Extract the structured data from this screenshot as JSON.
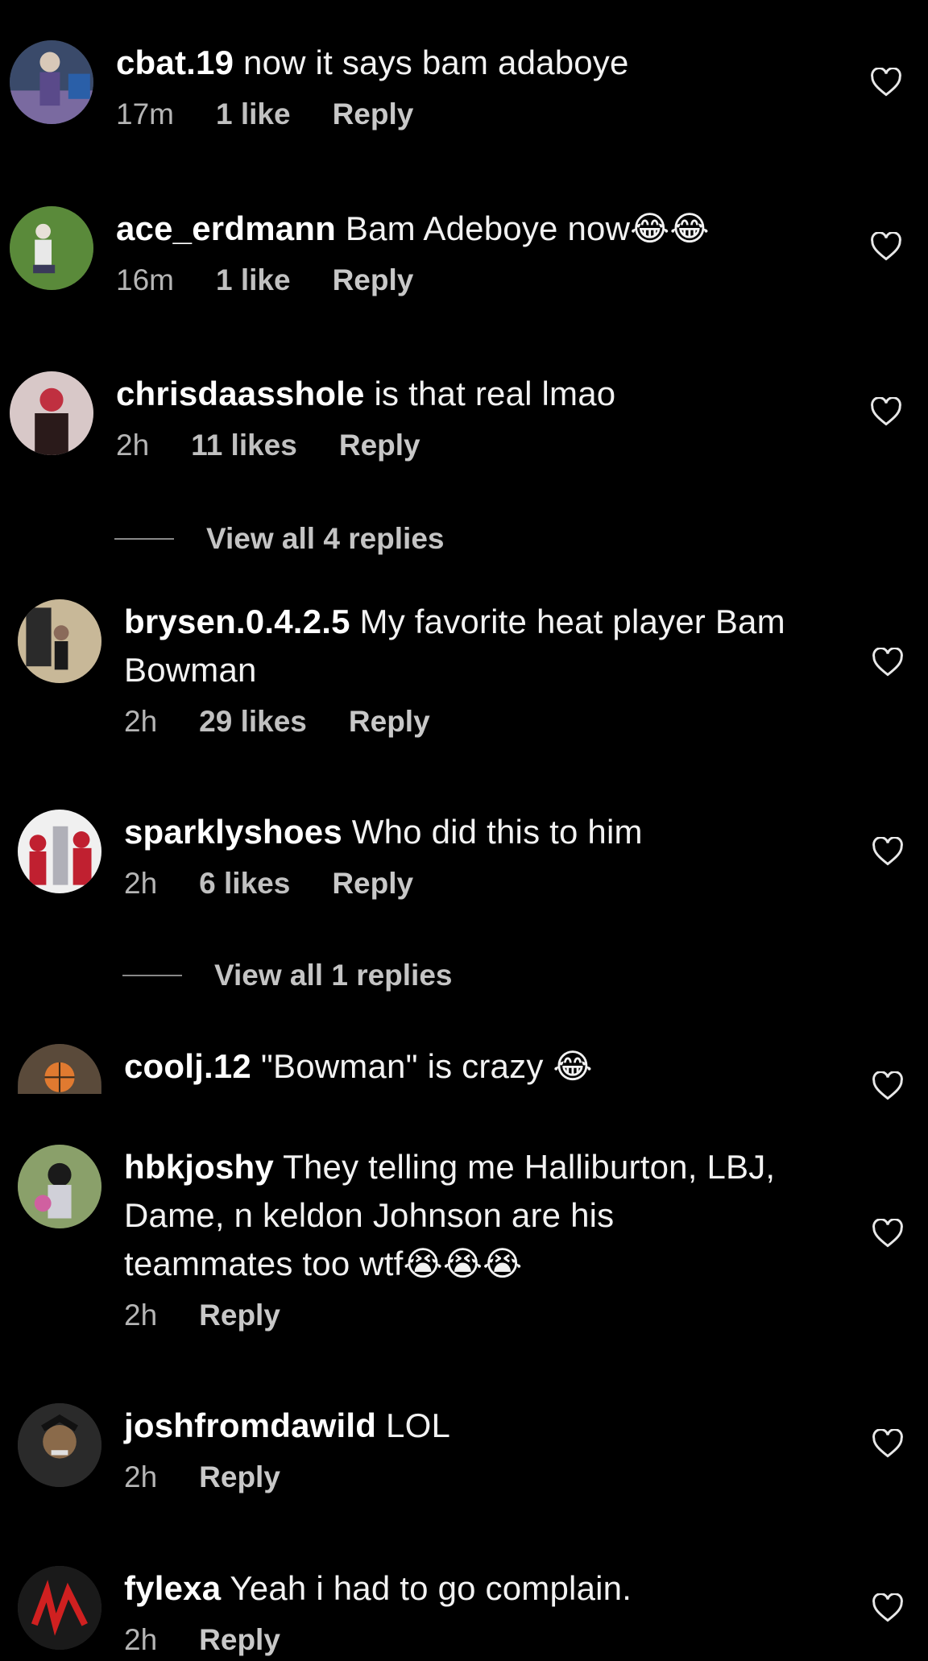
{
  "comments": [
    {
      "username": "cbat.19",
      "text": "now it says bam adaboye",
      "time": "17m",
      "likes": "1 like",
      "reply": "Reply"
    },
    {
      "username": "ace_erdmann",
      "text": "Bam Adeboye now",
      "emoji": "😂😂",
      "time": "16m",
      "likes": "1 like",
      "reply": "Reply"
    },
    {
      "username": "chrisdaasshole",
      "text": "is that real lmao",
      "time": "2h",
      "likes": "11 likes",
      "reply": "Reply",
      "view_replies": "View all 4 replies"
    },
    {
      "username": "brysen.0.4.2.5",
      "text_line1": "My favorite heat player Bam",
      "text_line2": "Bowman",
      "time": "2h",
      "likes": "29 likes",
      "reply": "Reply"
    },
    {
      "username": "sparklyshoes",
      "text": "Who did this to him",
      "time": "2h",
      "likes": "6 likes",
      "reply": "Reply",
      "view_replies": "View all 1 replies"
    },
    {
      "username": "coolj.12",
      "text": "\"Bowman\" is crazy",
      "emoji": "😂"
    },
    {
      "username": "hbkjoshy",
      "text_line1": "They telling me Halliburton, LBJ,",
      "text_line2": "Dame, n keldon Johnson are his",
      "text_line3": "teammates too wtf",
      "emoji": "😭😭😭",
      "time": "2h",
      "reply": "Reply"
    },
    {
      "username": "joshfromdawild",
      "text": "LOL",
      "time": "2h",
      "reply": "Reply"
    },
    {
      "username": "fylexa",
      "text": "Yeah i had to go complain.",
      "time": "2h",
      "reply": "Reply"
    }
  ],
  "icons": {
    "heart": "heart-outline-icon"
  },
  "colors": {
    "background": "#000000",
    "text": "#f2f2f2",
    "meta": "#b5b5b5"
  }
}
